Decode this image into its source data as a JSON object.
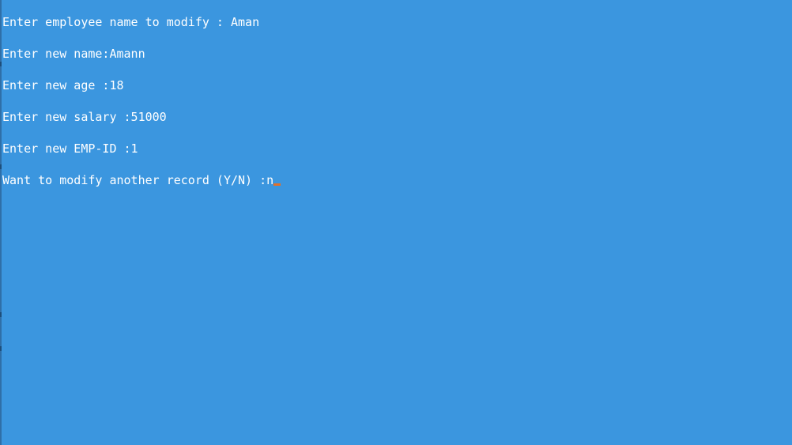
{
  "console": {
    "lines": [
      "Enter employee name to modify : Aman",
      "Enter new name:Amann",
      "Enter new age :18",
      "Enter new salary :51000",
      "Enter new EMP-ID :1"
    ],
    "prompt": "Want to modify another record (Y/N) :",
    "input_value": "n",
    "cursor_color": "#e2702a",
    "background_color": "#3b96df",
    "text_color": "#ffffff"
  }
}
